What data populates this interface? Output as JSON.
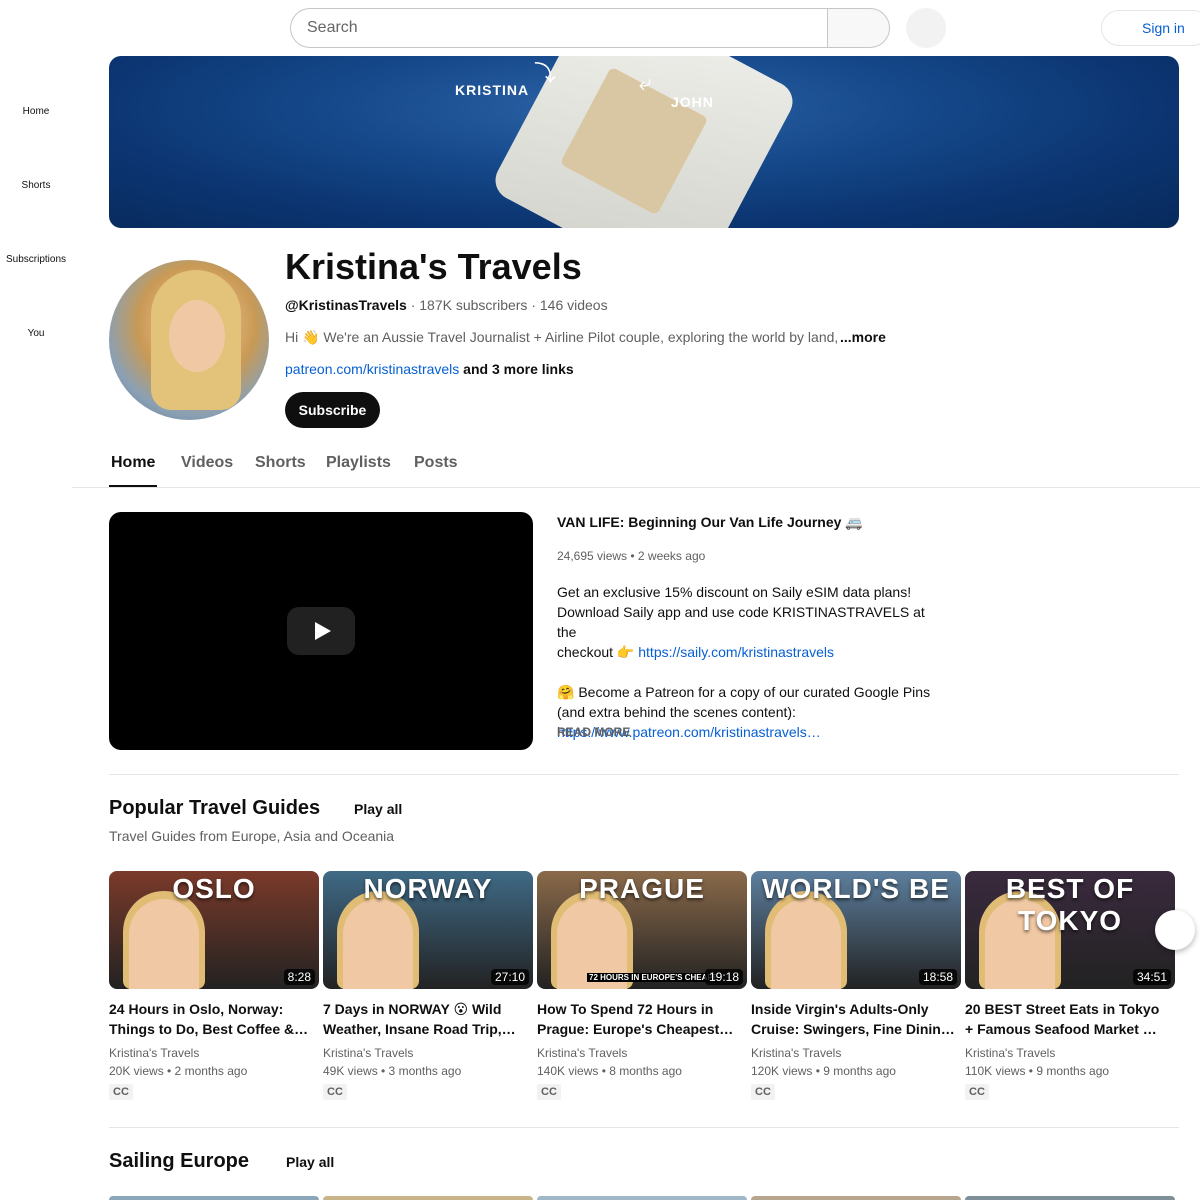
{
  "topbar": {
    "search_placeholder": "Search",
    "signin_label": "Sign in"
  },
  "sidebar": {
    "items": [
      {
        "label": "Home"
      },
      {
        "label": "Shorts"
      },
      {
        "label": "Subscriptions"
      },
      {
        "label": "You"
      }
    ]
  },
  "banner": {
    "label_left": "KRISTINA",
    "label_right": "JOHN"
  },
  "channel": {
    "title": "Kristina's Travels",
    "handle": "@KristinasTravels",
    "stats": " · 187K subscribers · 146 videos",
    "description": "Hi 👋 We're an Aussie Travel Journalist + Airline Pilot couple, exploring the world by land,",
    "more_label": "...more",
    "link_text": "patreon.com/kristinastravels",
    "more_links": " and 3 more links",
    "subscribe_label": "Subscribe"
  },
  "tabs": [
    {
      "label": "Home",
      "active": true
    },
    {
      "label": "Videos"
    },
    {
      "label": "Shorts"
    },
    {
      "label": "Playlists"
    },
    {
      "label": "Posts"
    }
  ],
  "featured": {
    "title": "VAN LIFE: Beginning Our Van Life Journey 🚐",
    "meta": "24,695 views • 2 weeks ago",
    "desc_line1": "Get an exclusive 15% discount on Saily eSIM data plans!",
    "desc_line2": "Download Saily app and use code KRISTINASTRAVELS at the",
    "desc_line3": "checkout 👉 ",
    "desc_link1": "https://saily.com/kristinastravels",
    "desc_line4": "🤗  Become a Patreon for a copy of our curated Google Pins",
    "desc_line5": "(and extra behind the scenes content):",
    "desc_link2": "https://www.patreon.com/kristinastravels…",
    "read_more": "READ MORE"
  },
  "shelf1": {
    "title": "Popular Travel Guides",
    "play_all": "Play all",
    "subtitle": "Travel Guides from Europe, Asia and Oceania",
    "videos": [
      {
        "thumb_text": "OSLO",
        "duration": "8:28",
        "title1": "24 Hours in Oslo, Norway:",
        "title2": "Things to Do, Best Coffee &…",
        "channel": "Kristina's Travels",
        "stats": "20K views • 2 months ago",
        "badge": "CC",
        "color": "#7a3a2a"
      },
      {
        "thumb_text": "NORWAY",
        "duration": "27:10",
        "title1": "7 Days in NORWAY 😮 Wild",
        "title2": "Weather, Insane Road Trip,…",
        "channel": "Kristina's Travels",
        "stats": "49K views • 3 months ago",
        "badge": "CC",
        "color": "#3f6a86"
      },
      {
        "thumb_text": "PRAGUE",
        "duration": "19:18",
        "title1": "How To Spend 72 Hours in",
        "title2": "Prague: Europe's Cheapest…",
        "channel": "Kristina's Travels",
        "stats": "140K views • 8 months ago",
        "badge": "CC",
        "color": "#8a6a4a",
        "caption": "72 HOURS IN EUROPE'S CHEAPE"
      },
      {
        "thumb_text": "WORLD'S BE",
        "duration": "18:58",
        "title1": "Inside Virgin's Adults-Only",
        "title2": "Cruise: Swingers, Fine Dinin…",
        "channel": "Kristina's Travels",
        "stats": "120K views • 9 months ago",
        "badge": "CC",
        "color": "#5d7f9e"
      },
      {
        "thumb_text": "BEST OF TOKYO",
        "duration": "34:51",
        "title1": "20 BEST Street Eats in Tokyo",
        "title2": "+ Famous Seafood Market …",
        "channel": "Kristina's Travels",
        "stats": "110K views • 9 months ago",
        "badge": "CC",
        "color": "#3a2a3e"
      }
    ]
  },
  "shelf2": {
    "title": "Sailing Europe",
    "play_all": "Play all"
  },
  "colors": {
    "link": "#065fd4",
    "text_primary": "#0f0f0f",
    "text_secondary": "#606060"
  }
}
